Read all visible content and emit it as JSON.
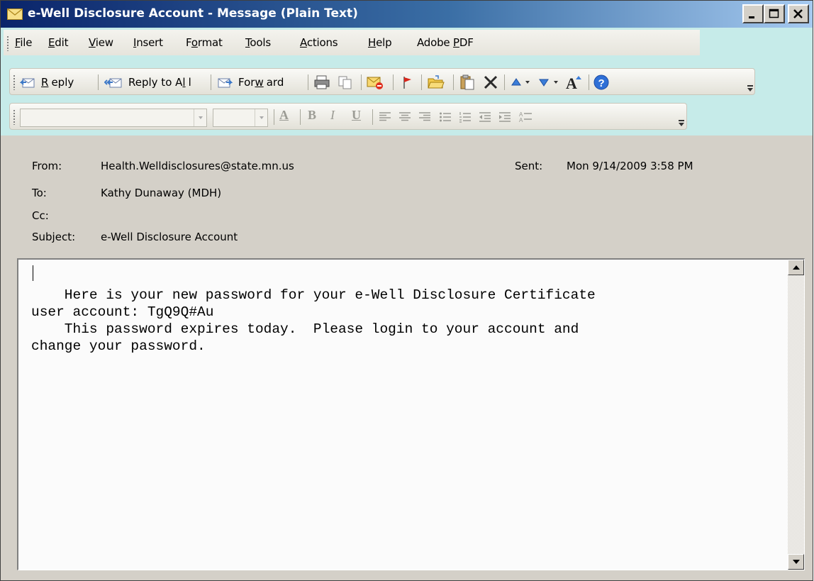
{
  "window": {
    "title": "e-Well Disclosure Account - Message (Plain Text)"
  },
  "menu": {
    "items": [
      {
        "pre": "",
        "key": "F",
        "post": "ile"
      },
      {
        "pre": "",
        "key": "E",
        "post": "dit"
      },
      {
        "pre": "",
        "key": "V",
        "post": "iew"
      },
      {
        "pre": "",
        "key": "I",
        "post": "nsert"
      },
      {
        "pre": "F",
        "key": "o",
        "post": "rmat"
      },
      {
        "pre": "",
        "key": "T",
        "post": "ools"
      },
      {
        "pre": "",
        "key": "A",
        "post": "ctions"
      },
      {
        "pre": "",
        "key": "H",
        "post": "elp"
      },
      {
        "pre": "Adobe ",
        "key": "P",
        "post": "DF"
      }
    ]
  },
  "toolbar": {
    "reply": {
      "pre": "",
      "key": "R",
      "post": "eply"
    },
    "reply_all": {
      "pre": "Reply to A",
      "key": "l",
      "post": "l"
    },
    "forward": {
      "pre": "For",
      "key": "w",
      "post": "ard"
    }
  },
  "formatting": {
    "font_name": "",
    "font_size": "",
    "bold": "B",
    "italic": "I",
    "underline": "U",
    "font_color": "A"
  },
  "header": {
    "from_label": "From:",
    "from_value": "Health.Welldisclosures@state.mn.us",
    "sent_label": "Sent:",
    "sent_value": "Mon 9/14/2009 3:58 PM",
    "to_label": "To:",
    "to_value": "Kathy Dunaway (MDH)",
    "cc_label": "Cc:",
    "cc_value": "",
    "subject_label": "Subject:",
    "subject_value": "e-Well Disclosure Account"
  },
  "message": {
    "body": "    Here is your new password for your e-Well Disclosure Certificate\nuser account: TgQ9Q#Au\n    This password expires today.  Please login to your account and\nchange your password."
  },
  "colors": {
    "title_gradient_start": "#0a246a",
    "title_gradient_end": "#a6caf0",
    "command_bar_bg": "#c6ebe9",
    "window_face": "#d4d0c8"
  }
}
